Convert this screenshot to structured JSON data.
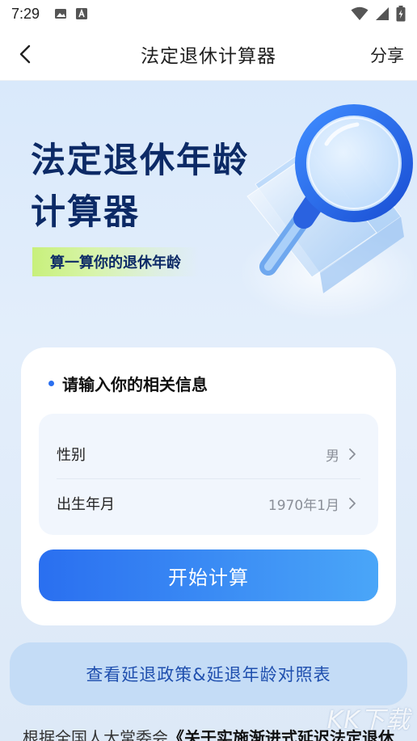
{
  "status_bar": {
    "time": "7:29",
    "icons": [
      "image-icon",
      "text-a-icon",
      "wifi-icon",
      "signal-icon",
      "battery-charging-icon"
    ]
  },
  "header": {
    "title": "法定退休计算器",
    "share_label": "分享",
    "back_icon": "chevron-left-icon"
  },
  "hero": {
    "title_line1": "法定退休年龄",
    "title_line2": "计算器",
    "tagline": "算一算你的退休年龄",
    "art_icon": "magnifier-illustration"
  },
  "form": {
    "title": "请输入你的相关信息",
    "fields": [
      {
        "label": "性别",
        "value": "男"
      },
      {
        "label": "出生年月",
        "value": "1970年1月"
      }
    ],
    "submit_label": "开始计算"
  },
  "policy_link": "查看延退政策&延退年龄对照表",
  "footer_text": {
    "prefix": "根据全国人大常委会",
    "title": "《关于实施渐进式延迟法定退休"
  },
  "watermark": "KK下载",
  "colors": {
    "accent": "#2a6ff0",
    "accent_light": "#4aa6f8",
    "hero_title": "#0c2a66",
    "background": "#dde9f7",
    "policy_bg": "#c4dcf6",
    "policy_text": "#1f4fae",
    "tag_green": "#c8f07b"
  }
}
